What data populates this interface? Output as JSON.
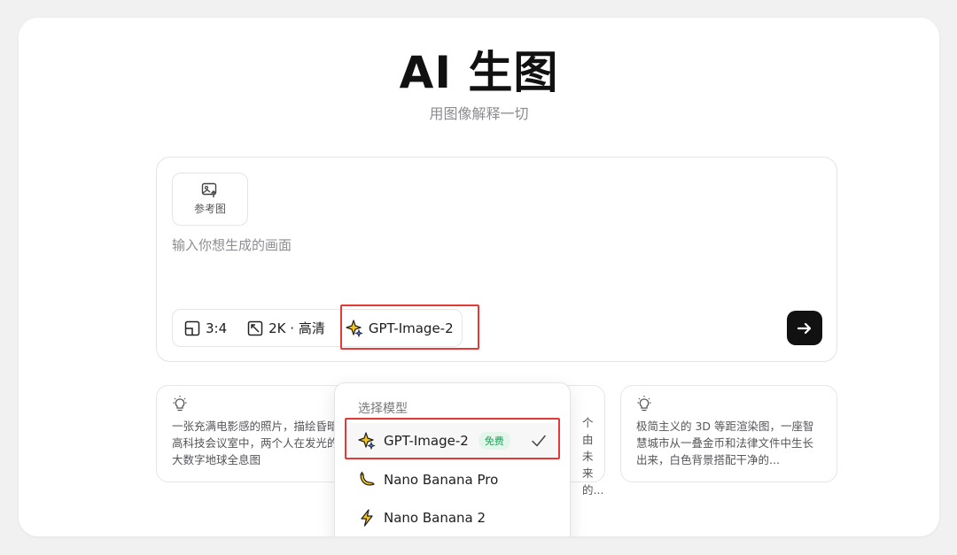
{
  "page": {
    "title": "AI 生图",
    "subtitle": "用图像解释一切"
  },
  "composer": {
    "reference_label": "参考图",
    "prompt_placeholder": "输入你想生成的画面",
    "aspect_ratio": "3:4",
    "resolution": "2K · 高清",
    "model": "GPT-Image-2",
    "send_icon": "arrow-right-icon"
  },
  "ideas": [
    {
      "icon": "lightbulb-icon",
      "text": "一张充满电影感的照片，描绘昏暗的高科技会议室中，两个人在发光的巨大数字地球全息图"
    },
    {
      "icon": "lightbulb-icon",
      "text": "个由未来的..."
    },
    {
      "icon": "lightbulb-icon",
      "text": "极简主义的 3D 等距渲染图，一座智慧城市从一叠金币和法律文件中生长出来，白色背景搭配干净的..."
    }
  ],
  "model_menu": {
    "header": "选择模型",
    "items": [
      {
        "label": "GPT-Image-2",
        "badge": "免费",
        "selected": true,
        "icon": "sparkle-star-icon"
      },
      {
        "label": "Nano Banana Pro",
        "selected": false,
        "icon": "banana-icon"
      },
      {
        "label": "Nano Banana 2",
        "selected": false,
        "icon": "lightning-icon"
      }
    ]
  },
  "colors": {
    "accent_dark": "#111111",
    "highlight_red": "#e53935",
    "badge_green": "#1e9e5a",
    "badge_bg": "#e3f6ea"
  }
}
